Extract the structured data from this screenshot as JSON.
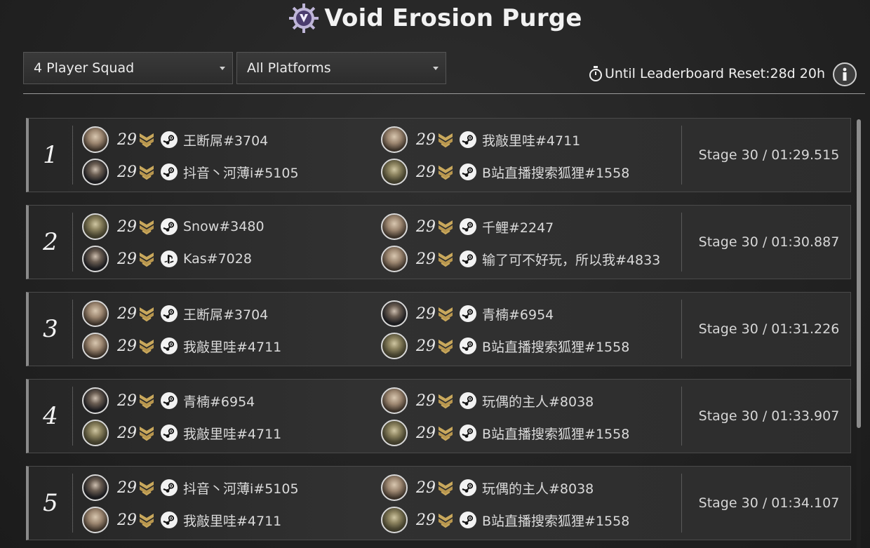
{
  "header": {
    "title": "Void Erosion Purge",
    "icon": "void-gear-emblem-icon"
  },
  "filters": {
    "squad": {
      "selected": "4 Player Squad"
    },
    "platform": {
      "selected": "All Platforms"
    }
  },
  "reset": {
    "label": "Until Leaderboard Reset:",
    "value": "28d 20h"
  },
  "colors": {
    "accent_gold": "#c9a85c",
    "background": "#232323",
    "row_border": "#8a8a8a"
  },
  "entries": [
    {
      "rank": "1",
      "result": "Stage 30 / 01:29.515",
      "players": [
        {
          "level": "29",
          "platform": "steam",
          "name": "王断屌#3704"
        },
        {
          "level": "29",
          "platform": "steam",
          "name": "抖音丶河薄i#5105"
        },
        {
          "level": "29",
          "platform": "steam",
          "name": "我敲里哇#4711"
        },
        {
          "level": "29",
          "platform": "steam",
          "name": "B站直播搜索狐狸#1558"
        }
      ]
    },
    {
      "rank": "2",
      "result": "Stage 30 / 01:30.887",
      "players": [
        {
          "level": "29",
          "platform": "steam",
          "name": "Snow#3480"
        },
        {
          "level": "29",
          "platform": "playstation",
          "name": "Kas#7028"
        },
        {
          "level": "29",
          "platform": "steam",
          "name": "千鲤#2247"
        },
        {
          "level": "29",
          "platform": "steam",
          "name": "输了可不好玩，所以我#4833"
        }
      ]
    },
    {
      "rank": "3",
      "result": "Stage 30 / 01:31.226",
      "players": [
        {
          "level": "29",
          "platform": "steam",
          "name": "王断屌#3704"
        },
        {
          "level": "29",
          "platform": "steam",
          "name": "我敲里哇#4711"
        },
        {
          "level": "29",
          "platform": "steam",
          "name": "青楠#6954"
        },
        {
          "level": "29",
          "platform": "steam",
          "name": "B站直播搜索狐狸#1558"
        }
      ]
    },
    {
      "rank": "4",
      "result": "Stage 30 / 01:33.907",
      "players": [
        {
          "level": "29",
          "platform": "steam",
          "name": "青楠#6954"
        },
        {
          "level": "29",
          "platform": "steam",
          "name": "我敲里哇#4711"
        },
        {
          "level": "29",
          "platform": "steam",
          "name": "玩偶的主人#8038"
        },
        {
          "level": "29",
          "platform": "steam",
          "name": "B站直播搜索狐狸#1558"
        }
      ]
    },
    {
      "rank": "5",
      "result": "Stage 30 / 01:34.107",
      "players": [
        {
          "level": "29",
          "platform": "steam",
          "name": "抖音丶河薄i#5105"
        },
        {
          "level": "29",
          "platform": "steam",
          "name": "我敲里哇#4711"
        },
        {
          "level": "29",
          "platform": "steam",
          "name": "玩偶的主人#8038"
        },
        {
          "level": "29",
          "platform": "steam",
          "name": "B站直播搜索狐狸#1558"
        }
      ]
    }
  ]
}
